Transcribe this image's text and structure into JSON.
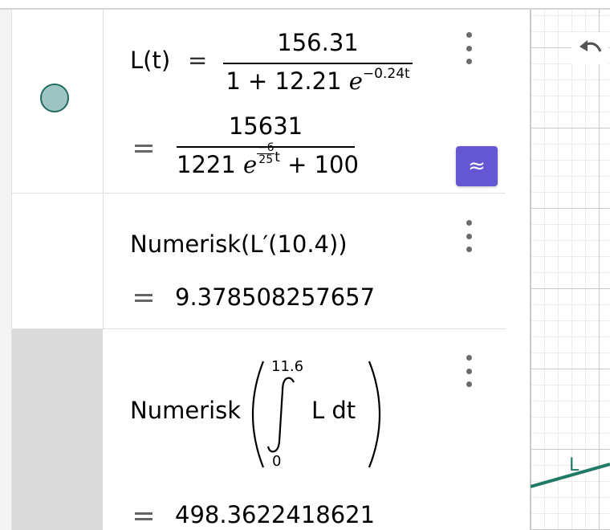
{
  "algebra": {
    "row1": {
      "lhs": "L(t)",
      "eq_sign": "=",
      "fraction1": {
        "numerator": "156.31",
        "den_prefix": "1 + 12.21",
        "den_base": "e",
        "den_exp": "−0.24t"
      },
      "fraction2": {
        "numerator": "15631",
        "den_coef": "1221",
        "den_base": "e",
        "exp_num": "−6",
        "exp_den": "25",
        "exp_var": "t",
        "den_suffix": "+ 100"
      },
      "approx_label": "≈"
    },
    "row2": {
      "input": "Numerisk(L′(10.4))",
      "result": "9.378508257657"
    },
    "row3": {
      "func": "Numerisk",
      "upper": "11.6",
      "lower": "0",
      "integrand": "L dt",
      "result": "498.3622418621"
    }
  },
  "graphics": {
    "curve_label": "L",
    "curve_color": "#1f7a66"
  },
  "colors": {
    "accent": "#6557d2",
    "marble_fill": "#9ec5c1",
    "marble_stroke": "#1f6d60"
  }
}
